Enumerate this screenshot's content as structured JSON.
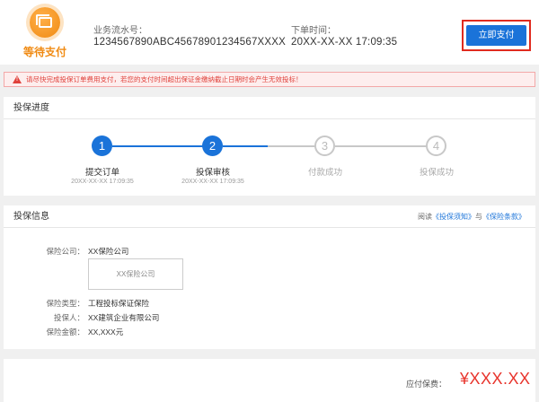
{
  "order": {
    "status": "等待支付",
    "serial_label": "业务流水号：",
    "serial_value": "1234567890ABC45678901234567XXXX",
    "time_label": "下单时间：",
    "time_value": "20XX-XX-XX 17:09:35",
    "pay_button": "立即支付"
  },
  "warning": "请尽快完成投保订单费用支付，若您的支付时间超出保证金缴纳截止日期时会产生无效投标！",
  "progress": {
    "title": "投保进度",
    "steps": [
      {
        "num": "1",
        "label": "提交订单",
        "time": "20XX-XX-XX 17:09:35",
        "done": true
      },
      {
        "num": "2",
        "label": "投保审核",
        "time": "20XX-XX-XX 17:09:35",
        "done": true
      },
      {
        "num": "3",
        "label": "付款成功",
        "time": "",
        "done": false
      },
      {
        "num": "4",
        "label": "投保成功",
        "time": "",
        "done": false
      }
    ],
    "colors": {
      "active": "#1a73d9",
      "inactive": "#c8c8c8"
    }
  },
  "info": {
    "title": "投保信息",
    "read_prefix": "阅读",
    "link_notice": "《投保须知》",
    "read_and": "与",
    "link_terms": "《保险条款》",
    "rows": {
      "insurer_label": "保险公司：",
      "insurer_value": "XX保险公司",
      "logo_text": "XX保险公司",
      "type_label": "保险类型：",
      "type_value": "工程投标保证保险",
      "holder_label": "投保人：",
      "holder_value": "XX建筑企业有限公司",
      "amount_label": "保险金额：",
      "amount_value": "XX,XXX元"
    }
  },
  "payment": {
    "due_label": "应付保费：",
    "due_amount": "¥XXX.XX"
  },
  "icons": {
    "status": "card-wallet-icon",
    "warning": "warning-triangle-icon"
  },
  "theme": {
    "accent": "#1a73d9",
    "warning": "#e0413b",
    "status": "#f08a12",
    "price": "#e8342c"
  }
}
